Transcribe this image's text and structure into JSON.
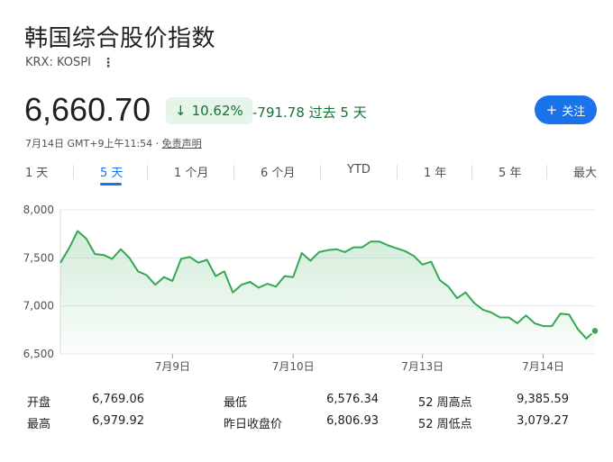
{
  "header": {
    "title": "韩国综合股价指数",
    "ticker": "KRX: KOSPI"
  },
  "quote": {
    "price": "6,660.70",
    "change_pct": "10.62%",
    "change_abs": "-791.78 过去 5 天",
    "follow_label": "关注",
    "timestamp": "7月14日 GMT+9上午11:54 · ",
    "disclaimer": "免责声明",
    "colors": {
      "positive": "#137333",
      "badge_bg": "#e6f4ea",
      "accent": "#1a73e8"
    }
  },
  "tabs": [
    {
      "label": "1 天",
      "active": false
    },
    {
      "label": "5 天",
      "active": true
    },
    {
      "label": "1 个月",
      "active": false
    },
    {
      "label": "6 个月",
      "active": false
    },
    {
      "label": "YTD",
      "active": false
    },
    {
      "label": "1 年",
      "active": false
    },
    {
      "label": "5 年",
      "active": false
    },
    {
      "label": "最大",
      "active": false
    }
  ],
  "chart_data": {
    "type": "area",
    "ylim": [
      6500,
      8000
    ],
    "y_ticks": [
      "8,000",
      "7,500",
      "7,000",
      "6,500"
    ],
    "y_tick_values": [
      8000,
      7500,
      7000,
      6500
    ],
    "x_tick_labels": [
      "7月9日",
      "7月10日",
      "7月13日",
      "7月14日"
    ],
    "x_tick_index": [
      13,
      27,
      42,
      56
    ],
    "grid": true,
    "line_color": "#34a853",
    "values": [
      7450,
      7600,
      7780,
      7700,
      7540,
      7530,
      7490,
      7590,
      7500,
      7360,
      7320,
      7220,
      7300,
      7260,
      7490,
      7510,
      7450,
      7480,
      7310,
      7360,
      7140,
      7220,
      7250,
      7190,
      7230,
      7200,
      7310,
      7300,
      7550,
      7470,
      7560,
      7580,
      7590,
      7560,
      7610,
      7610,
      7670,
      7670,
      7630,
      7600,
      7570,
      7520,
      7430,
      7460,
      7270,
      7200,
      7080,
      7140,
      7030,
      6960,
      6930,
      6880,
      6880,
      6820,
      6900,
      6820,
      6790,
      6790,
      6920,
      6910,
      6760,
      6660,
      6740
    ]
  },
  "stats": [
    {
      "label": "开盘",
      "value": "6,769.06"
    },
    {
      "label": "最高",
      "value": "6,979.92"
    },
    {
      "label": "最低",
      "value": "6,576.34"
    },
    {
      "label": "昨日收盘价",
      "value": "6,806.93"
    },
    {
      "label": "52 周高点",
      "value": "9,385.59"
    },
    {
      "label": "52 周低点",
      "value": "3,079.27"
    }
  ]
}
